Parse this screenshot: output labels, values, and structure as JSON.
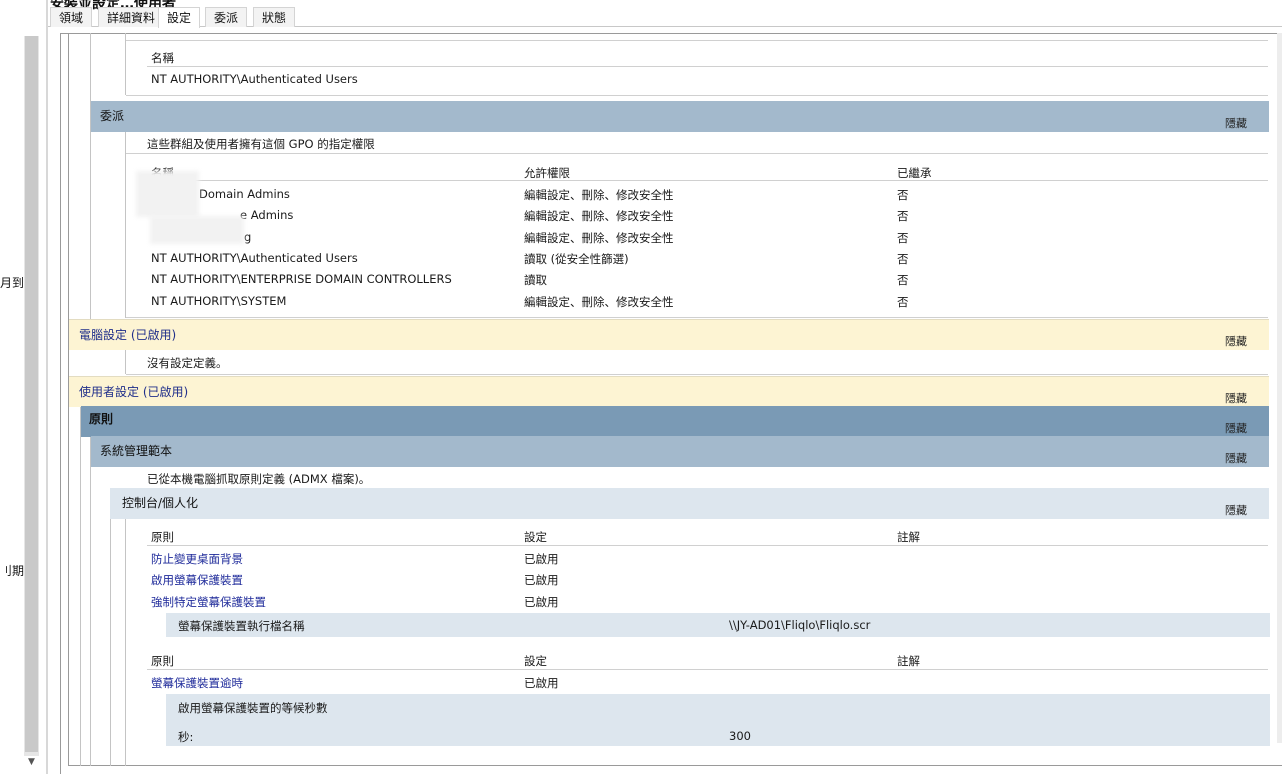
{
  "window": {
    "title_clipped": "安裝並設定…使用者"
  },
  "left_fragments": [
    "月到",
    "刂期"
  ],
  "tabs": [
    "領域",
    "詳細資料",
    "設定",
    "委派",
    "狀態"
  ],
  "hide_label": "隱藏",
  "top_table": {
    "header": "名稱",
    "value": "NT AUTHORITY\\Authenticated Users"
  },
  "delegation": {
    "title": "委派",
    "desc": "這些群組及使用者擁有這個 GPO 的指定權限",
    "headers": [
      "名稱",
      "允許權限",
      "已繼承"
    ],
    "rows": [
      {
        "name": "Domain Admins",
        "perm": "編輯設定、刪除、修改安全性",
        "inherit": "否"
      },
      {
        "name": "e Admins",
        "perm": "編輯設定、刪除、修改安全性",
        "inherit": "否"
      },
      {
        "name": "g",
        "perm": "編輯設定、刪除、修改安全性",
        "inherit": "否"
      },
      {
        "name": "NT AUTHORITY\\Authenticated Users",
        "perm": "讀取 (從安全性篩選)",
        "inherit": "否"
      },
      {
        "name": "NT AUTHORITY\\ENTERPRISE DOMAIN CONTROLLERS",
        "perm": "讀取",
        "inherit": "否"
      },
      {
        "name": "NT AUTHORITY\\SYSTEM",
        "perm": "編輯設定、刪除、修改安全性",
        "inherit": "否"
      }
    ]
  },
  "computer_config": {
    "title": "電腦設定 (已啟用)",
    "empty_text": "沒有設定定義。"
  },
  "user_config": {
    "title": "使用者設定 (已啟用)"
  },
  "policies": {
    "title": "原則"
  },
  "admin_templates": {
    "title": "系統管理範本",
    "desc": "已從本機電腦抓取原則定義 (ADMX 檔案)。"
  },
  "control_panel": {
    "title": "控制台/個人化",
    "headers": [
      "原則",
      "設定",
      "註解"
    ],
    "rows": [
      {
        "policy": "防止變更桌面背景",
        "setting": "已啟用"
      },
      {
        "policy": "啟用螢幕保護裝置",
        "setting": "已啟用"
      },
      {
        "policy": "強制特定螢幕保護裝置",
        "setting": "已啟用"
      }
    ],
    "sub1": {
      "label": "螢幕保護裝置執行檔名稱",
      "value": "\\\\JY-AD01\\Fliqlo\\Fliqlo.scr"
    },
    "headers2": [
      "原則",
      "設定",
      "註解"
    ],
    "row2": {
      "policy": "螢幕保護裝置逾時",
      "setting": "已啟用"
    },
    "sub2": {
      "title": "啟用螢幕保護裝置的等候秒數",
      "label": "秒:",
      "value": "300"
    }
  }
}
